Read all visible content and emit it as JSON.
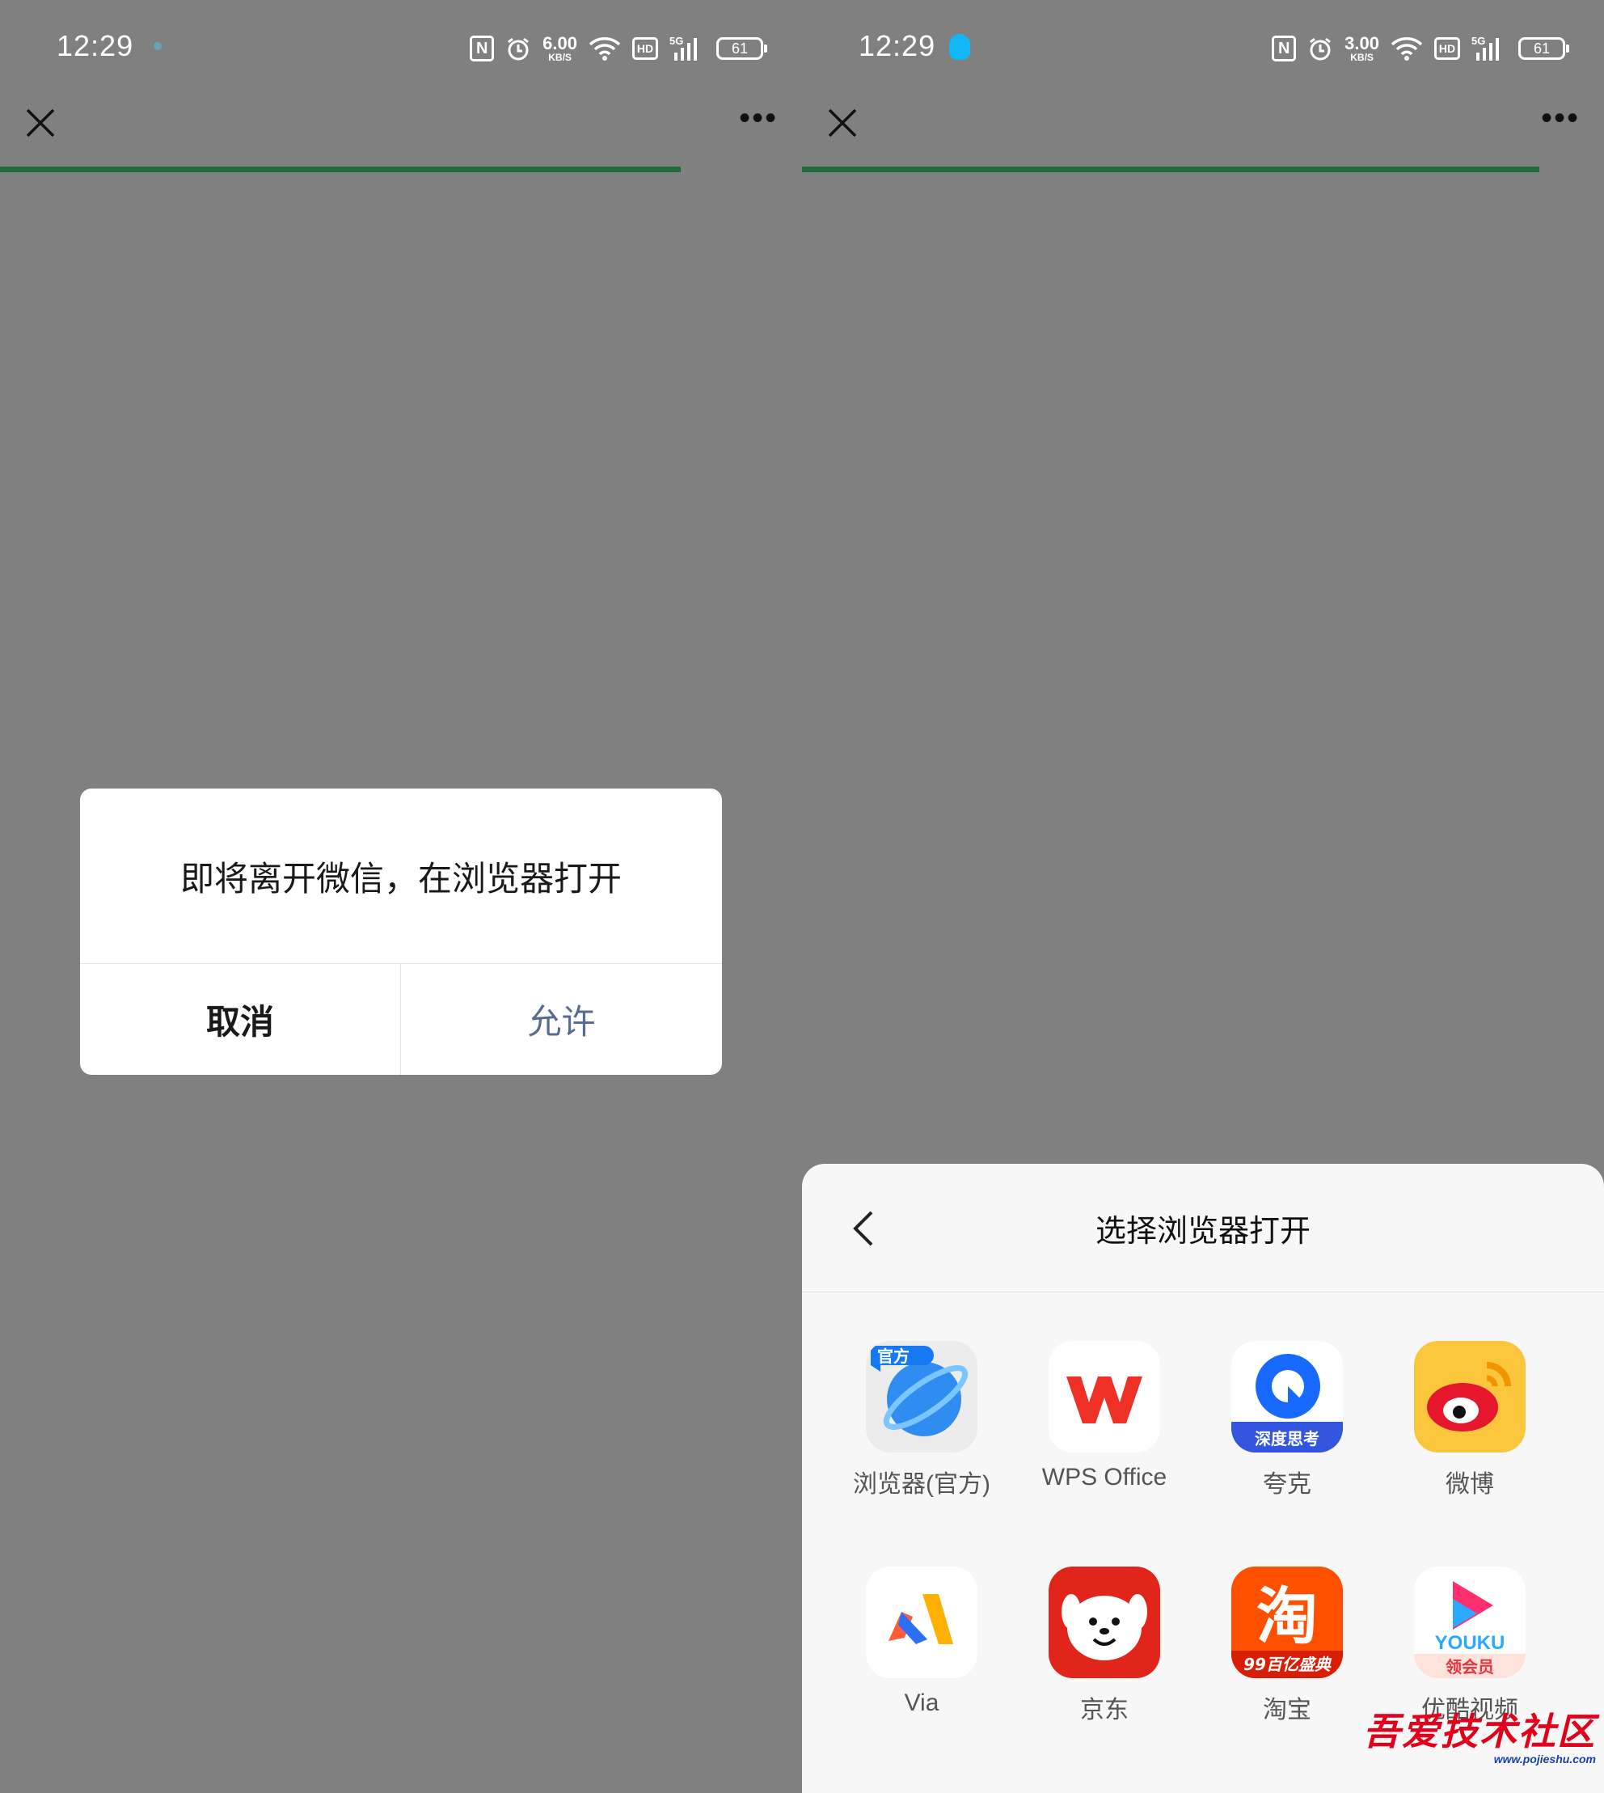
{
  "status_left": {
    "time": "12:29",
    "speed_value": "6.00",
    "speed_unit": "KB/S",
    "nfc": "N",
    "hd": "HD",
    "signal": "5G",
    "battery": "61"
  },
  "status_right": {
    "time": "12:29",
    "speed_value": "3.00",
    "speed_unit": "KB/S",
    "nfc": "N",
    "hd": "HD",
    "signal": "5G",
    "battery": "61"
  },
  "nav": {
    "more": "•••"
  },
  "dialog": {
    "message": "即将离开微信，在浏览器打开",
    "cancel_label": "取消",
    "allow_label": "允许"
  },
  "sheet": {
    "title": "选择浏览器打开",
    "apps": [
      {
        "label": "浏览器(官方)",
        "icon": "browser-official-icon",
        "badge": "官方"
      },
      {
        "label": "WPS Office",
        "icon": "wps-office-icon"
      },
      {
        "label": "夸克",
        "icon": "quark-icon",
        "badge": "深度思考"
      },
      {
        "label": "微博",
        "icon": "weibo-icon"
      },
      {
        "label": "Via",
        "icon": "via-icon"
      },
      {
        "label": "京东",
        "icon": "jd-icon"
      },
      {
        "label": "淘宝",
        "icon": "taobao-icon",
        "glyph": "淘",
        "badge": "99百亿盛典"
      },
      {
        "label": "优酷视频",
        "icon": "youku-icon",
        "brand": "YOUKU",
        "badge": "领会员"
      }
    ]
  },
  "watermark": {
    "main": "吾爱技术社区",
    "sub": "www.pojieshu.com"
  },
  "colors": {
    "background": "#808080",
    "progress": "#1f6b39",
    "allow_text": "#586b90",
    "qq": "#12b7f5"
  }
}
